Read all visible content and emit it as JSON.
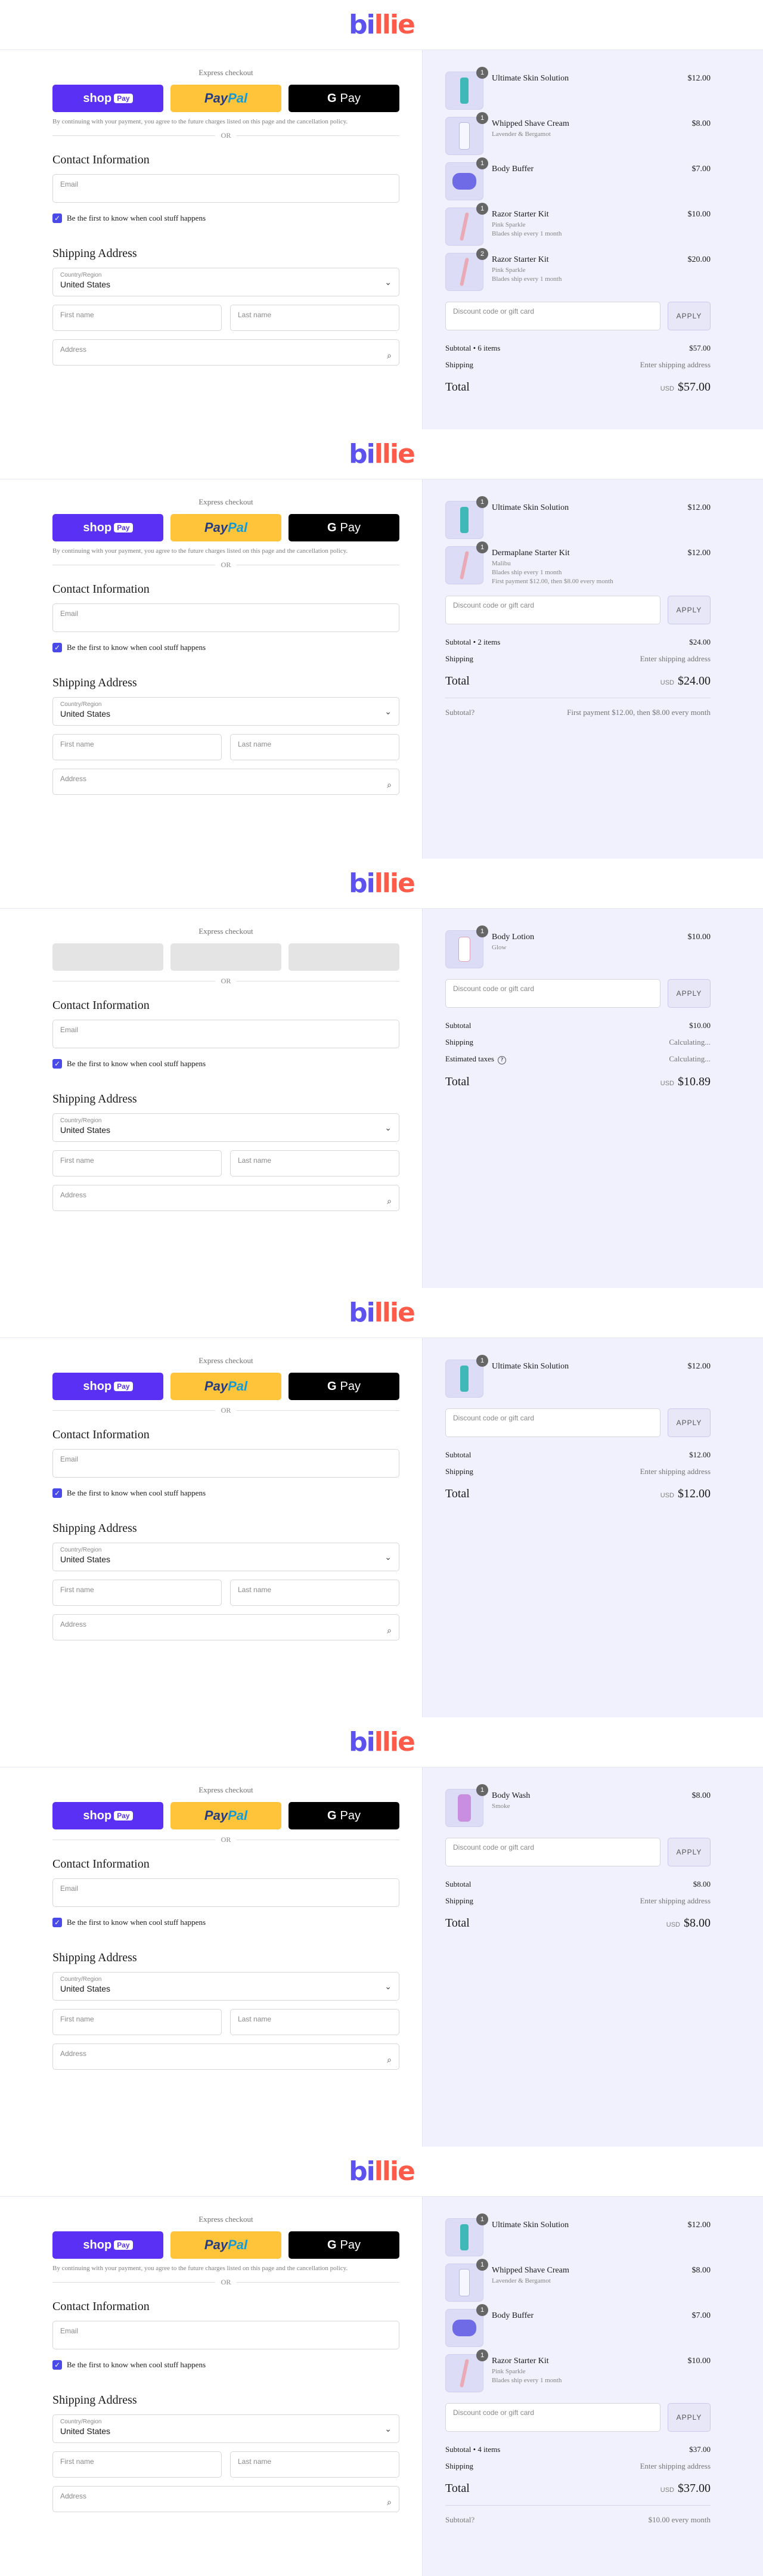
{
  "brand": {
    "logo": "billie"
  },
  "common": {
    "express_title": "Express checkout",
    "shop_label": "shop",
    "shop_pill": "Pay",
    "paypal_a": "Pay",
    "paypal_b": "Pal",
    "gpay_g": "G",
    "gpay_label": "Pay",
    "disclaimer": "By continuing with your payment, you agree to the future charges listed on this page and the cancellation policy.",
    "or": "OR",
    "contact_title": "Contact Information",
    "email_placeholder": "Email",
    "marketing_label": "Be the first to know when cool stuff happens",
    "checkmark": "✓",
    "shipping_title": "Shipping Address",
    "country_label": "Country/Region",
    "country_value": "United States",
    "first_name": "First name",
    "last_name": "Last name",
    "address": "Address",
    "discount_placeholder": "Discount code or gift card",
    "apply": "APPLY",
    "currency": "USD",
    "total_label": "Total",
    "shipping_label": "Shipping",
    "chevron": "⌄",
    "search": "⌕",
    "info": "?"
  },
  "panels": [
    {
      "express_loading": false,
      "show_disclaimer": true,
      "items": [
        {
          "name": "Ultimate Skin Solution",
          "sub": [],
          "price": "$12.00",
          "qty": "1",
          "thumb": "bottle"
        },
        {
          "name": "Whipped Shave Cream",
          "sub": [
            "Lavender & Bergamot"
          ],
          "price": "$8.00",
          "qty": "1",
          "thumb": "cream"
        },
        {
          "name": "Body Buffer",
          "sub": [],
          "price": "$7.00",
          "qty": "1",
          "thumb": "bar"
        },
        {
          "name": "Razor Starter Kit",
          "sub": [
            "Pink Sparkle",
            "Blades ship every 1 month"
          ],
          "price": "$10.00",
          "qty": "1",
          "thumb": "razor"
        },
        {
          "name": "Razor Starter Kit",
          "sub": [
            "Pink Sparkle",
            "Blades ship every 1 month"
          ],
          "price": "$20.00",
          "qty": "2",
          "thumb": "razor"
        }
      ],
      "subtotal_label": "Subtotal • 6 items",
      "subtotal": "$57.00",
      "shipping_value": "Enter shipping address",
      "taxes": null,
      "total": "$57.00",
      "future": null
    },
    {
      "express_loading": false,
      "show_disclaimer": true,
      "items": [
        {
          "name": "Ultimate Skin Solution",
          "sub": [],
          "price": "$12.00",
          "qty": "1",
          "thumb": "bottle"
        },
        {
          "name": "Dermaplane Starter Kit",
          "sub": [
            "Malibu",
            "Blades ship every 1 month",
            "First payment $12.00, then $8.00 every month"
          ],
          "price": "$12.00",
          "qty": "1",
          "thumb": "razor"
        }
      ],
      "subtotal_label": "Subtotal • 2 items",
      "subtotal": "$24.00",
      "shipping_value": "Enter shipping address",
      "taxes": null,
      "total": "$24.00",
      "future": {
        "label": "Subtotal",
        "value": "First payment $12.00, then $8.00 every month"
      }
    },
    {
      "express_loading": true,
      "show_disclaimer": false,
      "items": [
        {
          "name": "Body Lotion",
          "sub": [
            "Glow"
          ],
          "price": "$10.00",
          "qty": "1",
          "thumb": "lotion"
        }
      ],
      "subtotal_label": "Subtotal",
      "subtotal": "$10.00",
      "shipping_value": "Calculating...",
      "taxes": {
        "label": "Estimated taxes",
        "value": "Calculating..."
      },
      "total": "$10.89",
      "future": null
    },
    {
      "express_loading": false,
      "show_disclaimer": false,
      "items": [
        {
          "name": "Ultimate Skin Solution",
          "sub": [],
          "price": "$12.00",
          "qty": "1",
          "thumb": "bottle"
        }
      ],
      "subtotal_label": "Subtotal",
      "subtotal": "$12.00",
      "shipping_value": "Enter shipping address",
      "taxes": null,
      "total": "$12.00",
      "future": null
    },
    {
      "express_loading": false,
      "show_disclaimer": false,
      "items": [
        {
          "name": "Body Wash",
          "sub": [
            "Smoke"
          ],
          "price": "$8.00",
          "qty": "1",
          "thumb": "wash"
        }
      ],
      "subtotal_label": "Subtotal",
      "subtotal": "$8.00",
      "shipping_value": "Enter shipping address",
      "taxes": null,
      "total": "$8.00",
      "future": null
    },
    {
      "express_loading": false,
      "show_disclaimer": true,
      "items": [
        {
          "name": "Ultimate Skin Solution",
          "sub": [],
          "price": "$12.00",
          "qty": "1",
          "thumb": "bottle"
        },
        {
          "name": "Whipped Shave Cream",
          "sub": [
            "Lavender & Bergamot"
          ],
          "price": "$8.00",
          "qty": "1",
          "thumb": "cream"
        },
        {
          "name": "Body Buffer",
          "sub": [],
          "price": "$7.00",
          "qty": "1",
          "thumb": "bar"
        },
        {
          "name": "Razor Starter Kit",
          "sub": [
            "Pink Sparkle",
            "Blades ship every 1 month"
          ],
          "price": "$10.00",
          "qty": "1",
          "thumb": "razor"
        }
      ],
      "subtotal_label": "Subtotal • 4 items",
      "subtotal": "$37.00",
      "shipping_value": "Enter shipping address",
      "taxes": null,
      "total": "$37.00",
      "future": {
        "label": "Subtotal",
        "value": "$10.00 every month"
      }
    }
  ]
}
